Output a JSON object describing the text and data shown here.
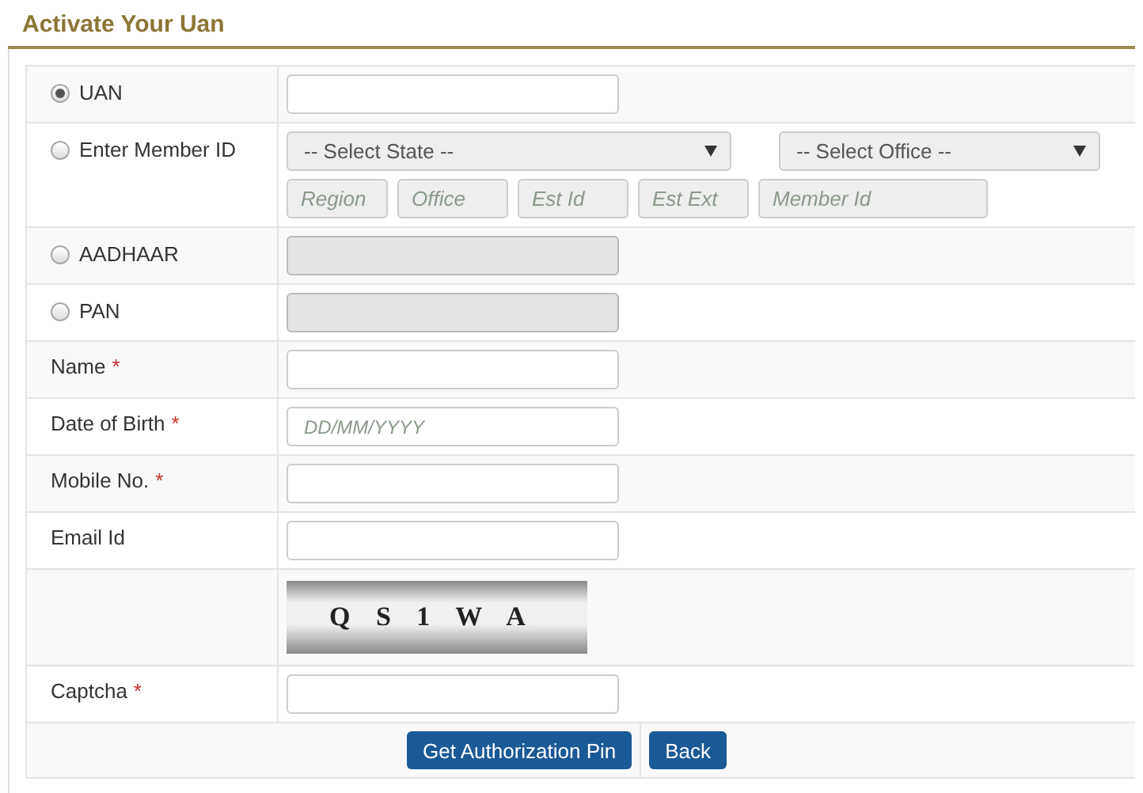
{
  "title": "Activate Your Uan",
  "rows": [
    {
      "kind": "radio",
      "label": "UAN",
      "selected": true,
      "field": {
        "disabled": false
      }
    },
    {
      "kind": "member",
      "label": "Enter Member ID",
      "selected": false,
      "selects": [
        "-- Select State --",
        "-- Select Office --"
      ],
      "parts": [
        "Region",
        "Office",
        "Est Id",
        "Est Ext",
        "Member Id"
      ]
    },
    {
      "kind": "radio",
      "label": "AADHAAR",
      "selected": false,
      "field": {
        "disabled": true
      }
    },
    {
      "kind": "radio",
      "label": "PAN",
      "selected": false,
      "field": {
        "disabled": true
      }
    },
    {
      "kind": "text",
      "label": "Name",
      "required_mark": "*",
      "field": {
        "disabled": false
      }
    },
    {
      "kind": "text",
      "label": "Date of Birth",
      "required_mark": "*",
      "field": {
        "disabled": false,
        "placeholder": "DD/MM/YYYY"
      }
    },
    {
      "kind": "text",
      "label": "Mobile No.",
      "required_mark": "*",
      "field": {
        "disabled": false
      }
    },
    {
      "kind": "text",
      "label": "Email Id",
      "field": {
        "disabled": false
      }
    },
    {
      "kind": "captcha",
      "text": "Q S 1 W A"
    },
    {
      "kind": "text",
      "label": "Captcha",
      "required_mark": "*",
      "field": {
        "disabled": false
      }
    }
  ],
  "buttons": [
    "Get Authorization Pin",
    "Back"
  ]
}
